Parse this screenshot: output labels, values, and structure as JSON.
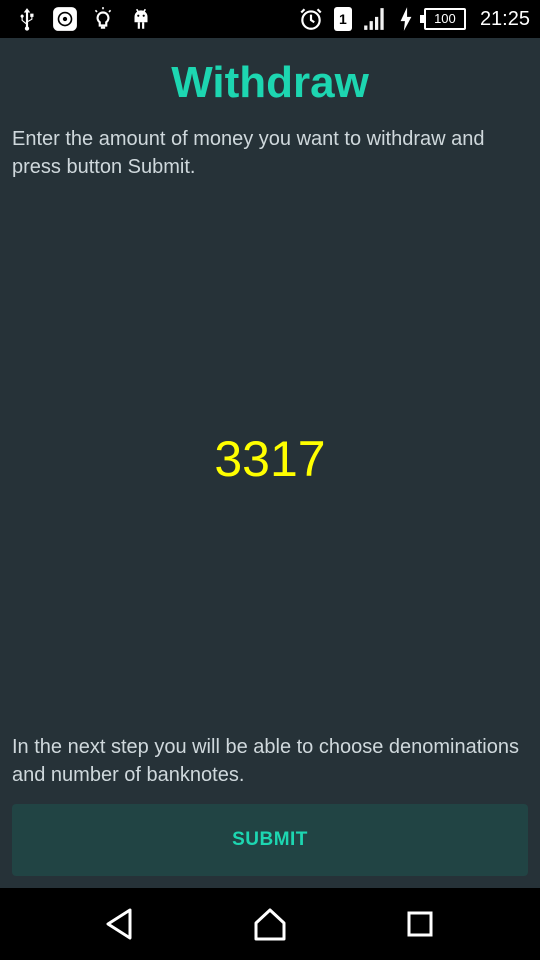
{
  "status_bar": {
    "time": "21:25",
    "sim_slot": "1",
    "battery_level": "100",
    "left_icons": [
      "usb-icon",
      "app-notification-icon",
      "lightbulb-icon",
      "android-icon"
    ],
    "right_icons": [
      "alarm-icon",
      "sim-icon",
      "signal-icon",
      "charging-icon",
      "battery-icon"
    ]
  },
  "screen": {
    "title": "Withdraw",
    "intro_text": "Enter the amount of money you want to withdraw and press button Submit.",
    "amount_value": "3317",
    "hint_text": "In the next step you will be able to choose denominations and number of banknotes.",
    "submit_label": "SUBMIT"
  },
  "colors": {
    "background": "#263238",
    "accent": "#1dd6b1",
    "amount": "#ffff00",
    "button": "#214444"
  },
  "nav_bar": {
    "buttons": [
      "back-icon",
      "home-icon",
      "recents-icon"
    ]
  }
}
